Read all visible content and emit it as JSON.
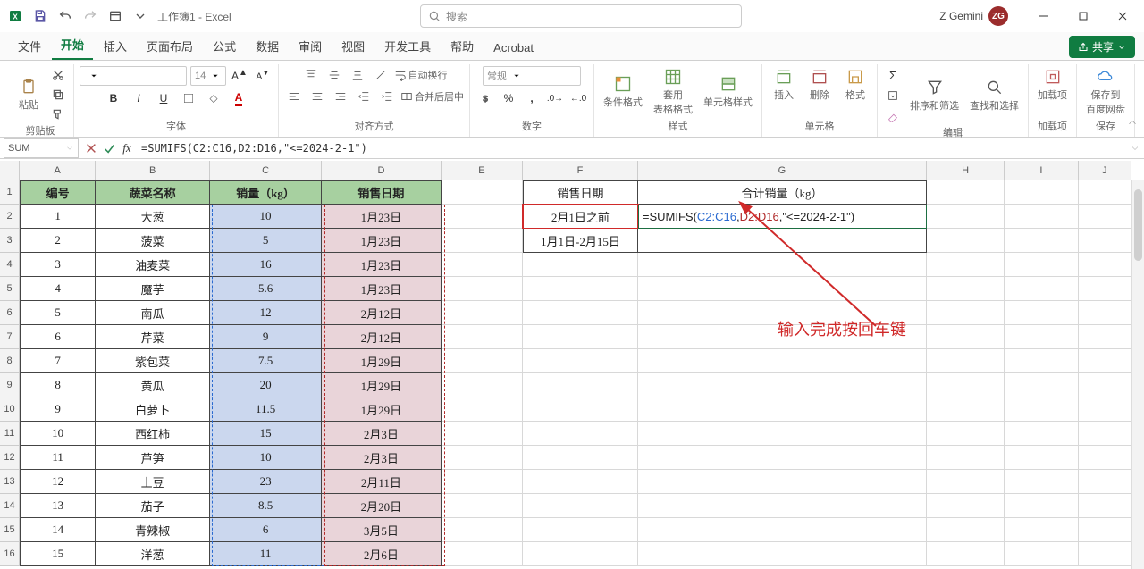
{
  "title": "工作簿1 - Excel",
  "search_placeholder": "搜索",
  "user": {
    "name": "Z Gemini",
    "initials": "ZG"
  },
  "tabs": {
    "file": "文件",
    "home": "开始",
    "insert": "插入",
    "layout": "页面布局",
    "formulas": "公式",
    "data": "数据",
    "review": "审阅",
    "view": "视图",
    "dev": "开发工具",
    "help": "帮助",
    "acrobat": "Acrobat"
  },
  "share_label": "共享",
  "ribbon": {
    "clipboard": {
      "paste": "粘贴",
      "group": "剪贴板"
    },
    "font": {
      "size": "14",
      "group": "字体"
    },
    "align": {
      "wrap": "自动换行",
      "merge": "合并后居中",
      "group": "对齐方式"
    },
    "number": {
      "name": "常规",
      "group": "数字"
    },
    "styles": {
      "cond": "条件格式",
      "table": "套用\n表格格式",
      "cell": "单元格样式",
      "group": "样式"
    },
    "cells": {
      "ins": "插入",
      "del": "删除",
      "fmt": "格式",
      "group": "单元格"
    },
    "editing": {
      "sort": "排序和筛选",
      "find": "查找和选择",
      "group": "编辑"
    },
    "addins": {
      "btn": "加载项",
      "group": "加载项"
    },
    "save": {
      "btn": "保存到\n百度网盘",
      "group": "保存"
    }
  },
  "namebox": "SUM",
  "formula_text": "=SUMIFS(C2:C16,D2:D16,\"<=2024-2-1\")",
  "columns": [
    "A",
    "B",
    "C",
    "D",
    "E",
    "F",
    "G",
    "H",
    "I",
    "J"
  ],
  "headers": {
    "a": "编号",
    "b": "蔬菜名称",
    "c": "销量（kg）",
    "d": "销售日期",
    "f": "销售日期",
    "g": "合计销量（kg）"
  },
  "rows": [
    {
      "a": "1",
      "b": "大葱",
      "c": "10",
      "d": "1月23日"
    },
    {
      "a": "2",
      "b": "菠菜",
      "c": "5",
      "d": "1月23日"
    },
    {
      "a": "3",
      "b": "油麦菜",
      "c": "16",
      "d": "1月23日"
    },
    {
      "a": "4",
      "b": "魔芋",
      "c": "5.6",
      "d": "1月23日"
    },
    {
      "a": "5",
      "b": "南瓜",
      "c": "12",
      "d": "2月12日"
    },
    {
      "a": "6",
      "b": "芹菜",
      "c": "9",
      "d": "2月12日"
    },
    {
      "a": "7",
      "b": "紫包菜",
      "c": "7.5",
      "d": "1月29日"
    },
    {
      "a": "8",
      "b": "黄瓜",
      "c": "20",
      "d": "1月29日"
    },
    {
      "a": "9",
      "b": "白萝卜",
      "c": "11.5",
      "d": "1月29日"
    },
    {
      "a": "10",
      "b": "西红柿",
      "c": "15",
      "d": "2月3日"
    },
    {
      "a": "11",
      "b": "芦笋",
      "c": "10",
      "d": "2月3日"
    },
    {
      "a": "12",
      "b": "土豆",
      "c": "23",
      "d": "2月11日"
    },
    {
      "a": "13",
      "b": "茄子",
      "c": "8.5",
      "d": "2月20日"
    },
    {
      "a": "14",
      "b": "青辣椒",
      "c": "6",
      "d": "3月5日"
    },
    {
      "a": "15",
      "b": "洋葱",
      "c": "11",
      "d": "2月6日"
    }
  ],
  "side": {
    "f2": "2月1日之前",
    "f3": "1月1日-2月15日",
    "g2": {
      "prefix": "=SUMIFS(",
      "r1": "C2:C16",
      "c1": ",",
      "r2": "D2:D16",
      "c2": ",",
      "r3": "\"<=2024-2-1\"",
      "suffix": ")"
    }
  },
  "annotation": "输入完成按回车键"
}
